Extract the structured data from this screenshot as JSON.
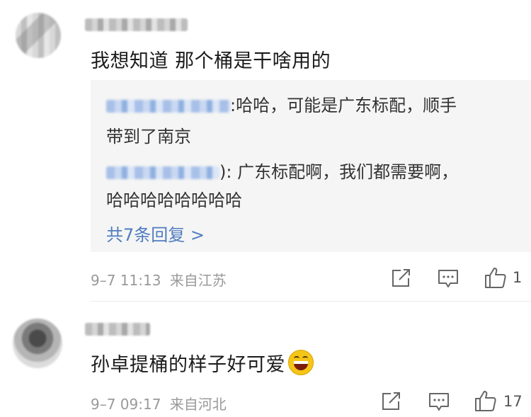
{
  "comments": [
    {
      "text": "我想知道 那个桶是干啥用的",
      "replies": [
        {
          "name_suffix": ":",
          "line1": "哈哈，可能是广东标配，顺手",
          "line2": "带到了南京"
        },
        {
          "name_suffix": "): ",
          "line1": "广东标配啊，我们都需要啊，",
          "line2": "哈哈哈哈哈哈哈哈"
        }
      ],
      "more_replies": "共7条回复 >",
      "time": "9–7 11:13",
      "location": "来自江苏",
      "likes": "1"
    },
    {
      "text": "孙卓提桶的样子好可爱",
      "emoji": "grin-icon",
      "time": "9–7 09:17",
      "location": "来自河北",
      "likes": "17"
    }
  ],
  "icons": {
    "share": "share-icon",
    "reply": "comment-icon",
    "like": "thumbs-up-icon"
  },
  "colors": {
    "link": "#4f7cc0",
    "meta": "#999999",
    "reply_bg": "#f5f5f5"
  }
}
